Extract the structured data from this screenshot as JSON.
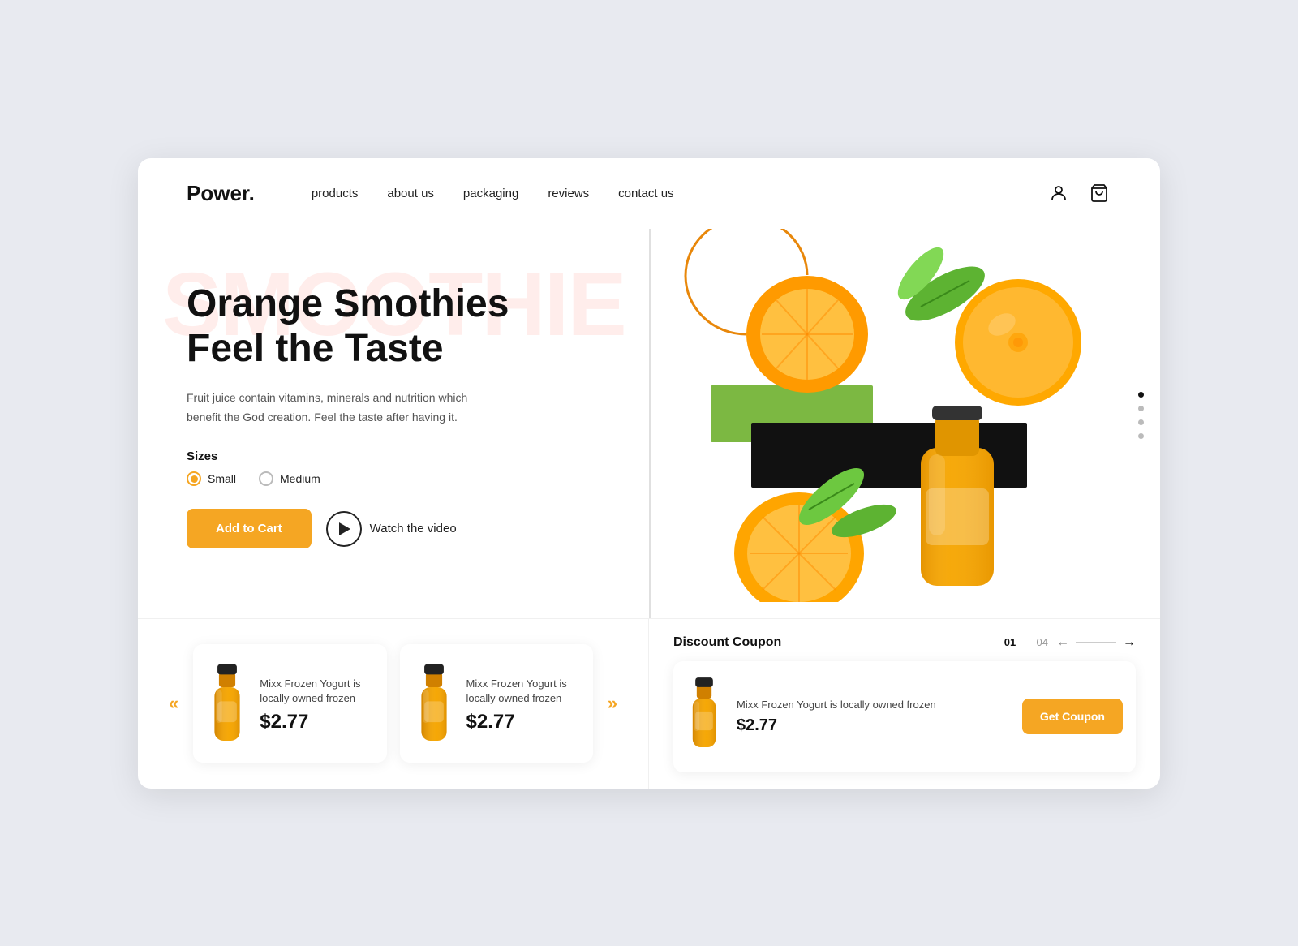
{
  "brand": {
    "name": "Power."
  },
  "nav": {
    "links": [
      {
        "label": "products",
        "id": "products"
      },
      {
        "label": "about us",
        "id": "about-us"
      },
      {
        "label": "packaging",
        "id": "packaging"
      },
      {
        "label": "reviews",
        "id": "reviews"
      },
      {
        "label": "contact us",
        "id": "contact-us"
      }
    ]
  },
  "hero": {
    "bg_text": "SMOOTHIE",
    "title_line1": "Orange Smothies",
    "title_line2": "Feel the Taste",
    "description": "Fruit juice contain vitamins, minerals and nutrition which benefit the God creation. Feel the taste after having it.",
    "sizes_label": "Sizes",
    "size_small": "Small",
    "size_medium": "Medium",
    "btn_cart": "Add to Cart",
    "btn_watch": "Watch the video"
  },
  "dots": [
    {
      "active": true
    },
    {
      "active": false
    },
    {
      "active": false
    },
    {
      "active": false
    }
  ],
  "products": [
    {
      "name": "Mixx Frozen Yogurt is locally owned frozen",
      "price": "$2.77"
    },
    {
      "name": "Mixx Frozen Yogurt is locally owned frozen",
      "price": "$2.77"
    }
  ],
  "discount": {
    "title": "Discount Coupon",
    "current": "01",
    "total": "04",
    "product_name": "Mixx Frozen Yogurt is locally owned frozen",
    "price": "$2.77",
    "btn_label": "Get Coupon"
  }
}
